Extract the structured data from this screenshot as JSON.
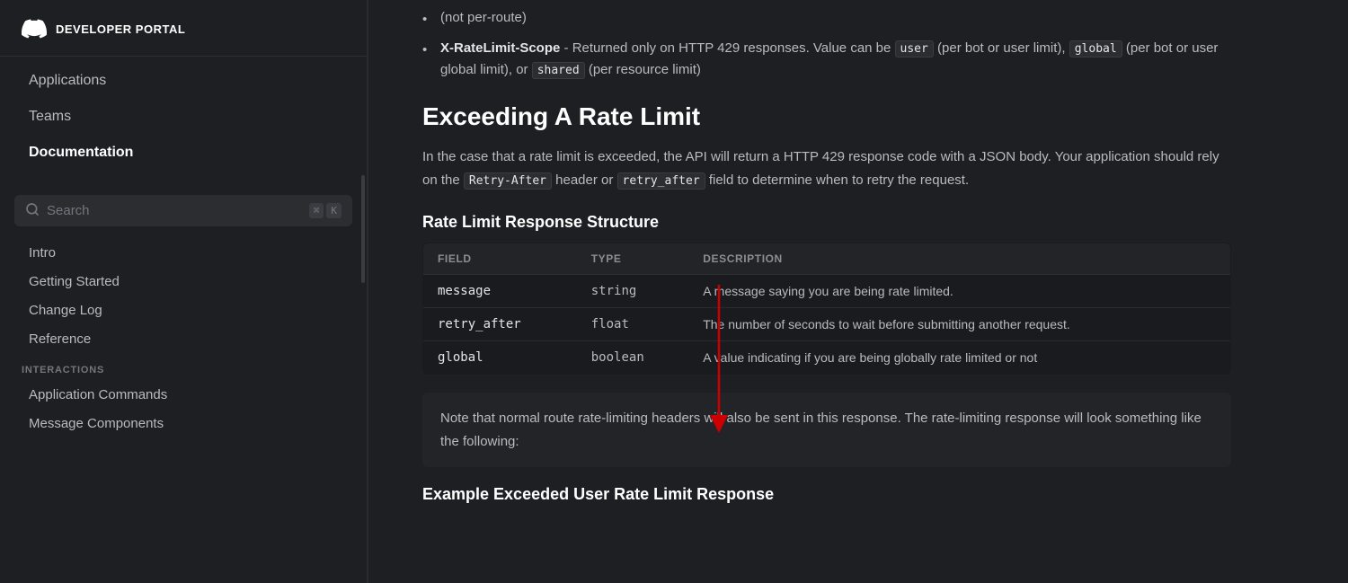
{
  "sidebar": {
    "logo_alt": "Discord Logo",
    "portal_title": "DEVELOPER PORTAL",
    "nav_items": [
      {
        "id": "applications",
        "label": "Applications",
        "active": false
      },
      {
        "id": "teams",
        "label": "Teams",
        "active": false
      },
      {
        "id": "documentation",
        "label": "Documentation",
        "active": true
      }
    ],
    "search": {
      "label": "Search",
      "kbd1": "⌘",
      "kbd2": "K"
    },
    "doc_items": [
      {
        "id": "intro",
        "label": "Intro"
      },
      {
        "id": "getting-started",
        "label": "Getting Started"
      },
      {
        "id": "change-log",
        "label": "Change Log"
      },
      {
        "id": "reference",
        "label": "Reference"
      }
    ],
    "interactions_label": "INTERACTIONS",
    "interaction_items": [
      {
        "id": "app-commands",
        "label": "Application Commands"
      },
      {
        "id": "message-components",
        "label": "Message Components"
      }
    ]
  },
  "main": {
    "intro_bullet": {
      "text": "(not per-route)"
    },
    "xratelimit_label": "X-RateLimit-Scope",
    "xratelimit_desc": "- Returned only on HTTP 429 responses. Value can be",
    "xratelimit_values": {
      "user": "user",
      "user_desc": "(per bot or user limit),",
      "global": "global",
      "global_desc": "(per bot or user global limit), or",
      "shared": "shared",
      "shared_desc": "(per resource limit)"
    },
    "section_title": "Exceeding A Rate Limit",
    "section_body": "In the case that a rate limit is exceeded, the API will return a HTTP 429 response code with a JSON body. Your application should rely on the",
    "retry_after_header": "Retry-After",
    "section_body2": "header or",
    "retry_after_field": "retry_after",
    "section_body3": "field to determine when to retry the request.",
    "table_title": "Rate Limit Response Structure",
    "table_headers": [
      "FIELD",
      "TYPE",
      "DESCRIPTION"
    ],
    "table_rows": [
      {
        "field": "message",
        "type": "string",
        "description": "A message saying you are being rate limited."
      },
      {
        "field": "retry_after",
        "type": "float",
        "description": "The number of seconds to wait before submitting another request."
      },
      {
        "field": "global",
        "type": "boolean",
        "description": "A value indicating if you are being globally rate limited or not"
      }
    ],
    "note_text": "Note that normal route rate-limiting headers will also be sent in this response. The rate-limiting response will look something like the following:",
    "example_title": "Example Exceeded User Rate Limit Response"
  }
}
